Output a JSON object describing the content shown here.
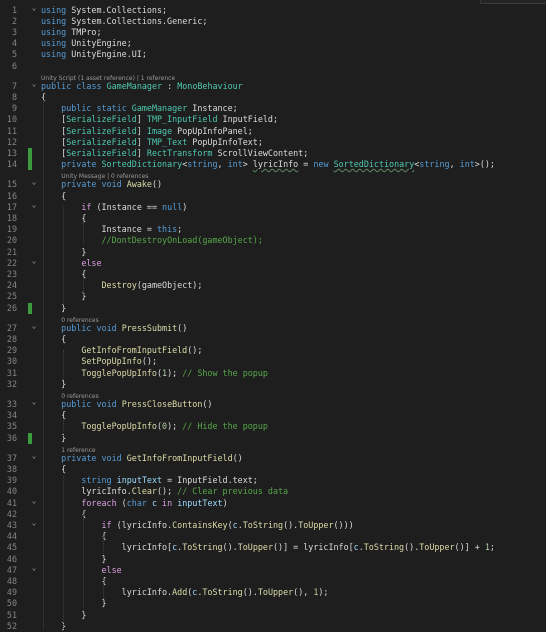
{
  "editor": {
    "language": "csharp",
    "theme_background": "#1e1e1e",
    "colors": {
      "keyword": "#569cd6",
      "control": "#d8a0df",
      "type": "#4ec9b0",
      "method": "#dcdcaa",
      "comment": "#57a64a",
      "variable": "#9cdcfe",
      "number": "#b5cea8",
      "text": "#dcdcdc",
      "line_number": "#858585",
      "change_marker": "#3c9b3c"
    },
    "lines": [
      {
        "n": "1",
        "fold": "collapse",
        "tokens": [
          [
            "kw",
            "using"
          ],
          [
            "pl",
            " System.Collections;"
          ]
        ]
      },
      {
        "n": "2",
        "tokens": [
          [
            "kw",
            "using"
          ],
          [
            "pl",
            " System.Collections.Generic;"
          ]
        ]
      },
      {
        "n": "3",
        "tokens": [
          [
            "kw",
            "using"
          ],
          [
            "pl",
            " TMPro;"
          ]
        ]
      },
      {
        "n": "4",
        "tokens": [
          [
            "kw",
            "using"
          ],
          [
            "pl",
            " UnityEngine;"
          ]
        ]
      },
      {
        "n": "5",
        "tokens": [
          [
            "kw",
            "using"
          ],
          [
            "pl",
            " UnityEngine.UI;"
          ]
        ]
      },
      {
        "n": "6",
        "tokens": []
      },
      {
        "lens": "Unity Script (1 asset reference) | 1 reference"
      },
      {
        "n": "7",
        "fold": "collapse",
        "tokens": [
          [
            "kw",
            "public"
          ],
          [
            "pl",
            " "
          ],
          [
            "kw",
            "class"
          ],
          [
            "pl",
            " "
          ],
          [
            "ty",
            "GameManager"
          ],
          [
            "pl",
            " : "
          ],
          [
            "ty",
            "MonoBehaviour"
          ]
        ]
      },
      {
        "n": "8",
        "tokens": [
          [
            "pl",
            "{"
          ]
        ]
      },
      {
        "n": "9",
        "tokens": [
          [
            "pl",
            "    "
          ],
          [
            "kw",
            "public"
          ],
          [
            "pl",
            " "
          ],
          [
            "kw",
            "static"
          ],
          [
            "pl",
            " "
          ],
          [
            "ty",
            "GameManager"
          ],
          [
            "pl",
            " Instance;"
          ]
        ]
      },
      {
        "n": "10",
        "tokens": [
          [
            "pl",
            "    ["
          ],
          [
            "at",
            "SerializeField"
          ],
          [
            "pl",
            "] "
          ],
          [
            "ty",
            "TMP_InputField"
          ],
          [
            "pl",
            " InputField;"
          ]
        ]
      },
      {
        "n": "11",
        "tokens": [
          [
            "pl",
            "    ["
          ],
          [
            "at",
            "SerializeField"
          ],
          [
            "pl",
            "] "
          ],
          [
            "ty",
            "Image"
          ],
          [
            "pl",
            " PopUpInfoPanel;"
          ]
        ]
      },
      {
        "n": "12",
        "tokens": [
          [
            "pl",
            "    ["
          ],
          [
            "at",
            "SerializeField"
          ],
          [
            "pl",
            "] "
          ],
          [
            "ty",
            "TMP_Text"
          ],
          [
            "pl",
            " PopUpInfoText;"
          ]
        ]
      },
      {
        "n": "13",
        "marker": true,
        "tokens": [
          [
            "pl",
            "    ["
          ],
          [
            "at",
            "SerializeField"
          ],
          [
            "pl",
            "] "
          ],
          [
            "ty",
            "RectTransform"
          ],
          [
            "pl",
            " ScrollViewContent;"
          ]
        ]
      },
      {
        "n": "14",
        "marker": true,
        "tokens": [
          [
            "pl",
            "    "
          ],
          [
            "kw",
            "private"
          ],
          [
            "pl",
            " "
          ],
          [
            "ty",
            "SortedDictionary"
          ],
          [
            "pl",
            "<"
          ],
          [
            "kw",
            "string"
          ],
          [
            "pl",
            ", "
          ],
          [
            "kw",
            "int"
          ],
          [
            "pl",
            "> "
          ],
          [
            "sq",
            "lyricInfo"
          ],
          [
            "pl",
            " = "
          ],
          [
            "kw",
            "new"
          ],
          [
            "pl",
            " "
          ],
          [
            "tysq",
            "SortedDictionary"
          ],
          [
            "pl",
            "<"
          ],
          [
            "kw",
            "string"
          ],
          [
            "pl",
            ", "
          ],
          [
            "kw",
            "int"
          ],
          [
            "pl",
            ">();"
          ]
        ]
      },
      {
        "lens": "Unity Message | 0 references",
        "indent": "    "
      },
      {
        "n": "15",
        "fold": "collapse",
        "tokens": [
          [
            "pl",
            "    "
          ],
          [
            "kw",
            "private"
          ],
          [
            "pl",
            " "
          ],
          [
            "kw",
            "void"
          ],
          [
            "pl",
            " "
          ],
          [
            "fn",
            "Awake"
          ],
          [
            "pl",
            "()"
          ]
        ]
      },
      {
        "n": "16",
        "tokens": [
          [
            "pl",
            "    {"
          ]
        ]
      },
      {
        "n": "17",
        "fold": "collapse",
        "tokens": [
          [
            "pl",
            "        "
          ],
          [
            "kw2",
            "if"
          ],
          [
            "pl",
            " (Instance == "
          ],
          [
            "kw",
            "null"
          ],
          [
            "pl",
            ")"
          ]
        ]
      },
      {
        "n": "18",
        "tokens": [
          [
            "pl",
            "        {"
          ]
        ]
      },
      {
        "n": "19",
        "tokens": [
          [
            "pl",
            "            Instance = "
          ],
          [
            "kw",
            "this"
          ],
          [
            "pl",
            ";"
          ]
        ]
      },
      {
        "n": "20",
        "tokens": [
          [
            "pl",
            "            "
          ],
          [
            "cm",
            "//DontDestroyOnLoad(gameObject);"
          ]
        ]
      },
      {
        "n": "21",
        "tokens": [
          [
            "pl",
            "        }"
          ]
        ]
      },
      {
        "n": "22",
        "fold": "collapse",
        "tokens": [
          [
            "pl",
            "        "
          ],
          [
            "kw2",
            "else"
          ]
        ]
      },
      {
        "n": "23",
        "tokens": [
          [
            "pl",
            "        {"
          ]
        ]
      },
      {
        "n": "24",
        "tokens": [
          [
            "pl",
            "            "
          ],
          [
            "fn",
            "Destroy"
          ],
          [
            "pl",
            "(gameObject);"
          ]
        ]
      },
      {
        "n": "25",
        "tokens": [
          [
            "pl",
            "        }"
          ]
        ]
      },
      {
        "n": "26",
        "marker": true,
        "tokens": [
          [
            "pl",
            "    }"
          ]
        ]
      },
      {
        "lens": "0 references",
        "indent": "    "
      },
      {
        "n": "27",
        "fold": "collapse",
        "tokens": [
          [
            "pl",
            "    "
          ],
          [
            "kw",
            "public"
          ],
          [
            "pl",
            " "
          ],
          [
            "kw",
            "void"
          ],
          [
            "pl",
            " "
          ],
          [
            "fn",
            "PressSubmit"
          ],
          [
            "pl",
            "()"
          ]
        ]
      },
      {
        "n": "28",
        "tokens": [
          [
            "pl",
            "    {"
          ]
        ]
      },
      {
        "n": "29",
        "tokens": [
          [
            "pl",
            "        "
          ],
          [
            "fn",
            "GetInfoFromInputField"
          ],
          [
            "pl",
            "();"
          ]
        ]
      },
      {
        "n": "30",
        "tokens": [
          [
            "pl",
            "        "
          ],
          [
            "fn",
            "SetPopUpInfo"
          ],
          [
            "pl",
            "();"
          ]
        ]
      },
      {
        "n": "31",
        "tokens": [
          [
            "pl",
            "        "
          ],
          [
            "fn",
            "TogglePopUpInfo"
          ],
          [
            "pl",
            "("
          ],
          [
            "nm",
            "1"
          ],
          [
            "pl",
            "); "
          ],
          [
            "cm",
            "// Show the popup"
          ]
        ]
      },
      {
        "n": "32",
        "tokens": [
          [
            "pl",
            "    }"
          ]
        ]
      },
      {
        "lens": "0 references",
        "indent": "    "
      },
      {
        "n": "33",
        "fold": "collapse",
        "tokens": [
          [
            "pl",
            "    "
          ],
          [
            "kw",
            "public"
          ],
          [
            "pl",
            " "
          ],
          [
            "kw",
            "void"
          ],
          [
            "pl",
            " "
          ],
          [
            "fn",
            "PressCloseButton"
          ],
          [
            "pl",
            "()"
          ]
        ]
      },
      {
        "n": "34",
        "tokens": [
          [
            "pl",
            "    {"
          ]
        ]
      },
      {
        "n": "35",
        "tokens": [
          [
            "pl",
            "        "
          ],
          [
            "fn",
            "TogglePopUpInfo"
          ],
          [
            "pl",
            "("
          ],
          [
            "nm",
            "0"
          ],
          [
            "pl",
            "); "
          ],
          [
            "cm",
            "// Hide the popup"
          ]
        ]
      },
      {
        "n": "36",
        "marker": true,
        "tokens": [
          [
            "pl",
            "    }"
          ]
        ]
      },
      {
        "lens": "1 reference",
        "indent": "    "
      },
      {
        "n": "37",
        "fold": "collapse",
        "tokens": [
          [
            "pl",
            "    "
          ],
          [
            "kw",
            "private"
          ],
          [
            "pl",
            " "
          ],
          [
            "kw",
            "void"
          ],
          [
            "pl",
            " "
          ],
          [
            "fn",
            "GetInfoFromInputField"
          ],
          [
            "pl",
            "()"
          ]
        ]
      },
      {
        "n": "38",
        "tokens": [
          [
            "pl",
            "    {"
          ]
        ]
      },
      {
        "n": "39",
        "tokens": [
          [
            "pl",
            "        "
          ],
          [
            "kw",
            "string"
          ],
          [
            "pl",
            " "
          ],
          [
            "vr",
            "inputText"
          ],
          [
            "pl",
            " = InputField.text;"
          ]
        ]
      },
      {
        "n": "40",
        "tokens": [
          [
            "pl",
            "        lyricInfo."
          ],
          [
            "fn",
            "Clear"
          ],
          [
            "pl",
            "(); "
          ],
          [
            "cm",
            "// Clear previous data"
          ]
        ]
      },
      {
        "n": "41",
        "fold": "collapse",
        "tokens": [
          [
            "pl",
            "        "
          ],
          [
            "kw2",
            "foreach"
          ],
          [
            "pl",
            " ("
          ],
          [
            "kw",
            "char"
          ],
          [
            "pl",
            " "
          ],
          [
            "vr",
            "c"
          ],
          [
            "pl",
            " "
          ],
          [
            "kw2",
            "in"
          ],
          [
            "pl",
            " "
          ],
          [
            "vr",
            "inputText"
          ],
          [
            "pl",
            ")"
          ]
        ]
      },
      {
        "n": "42",
        "tokens": [
          [
            "pl",
            "        {"
          ]
        ]
      },
      {
        "n": "43",
        "fold": "collapse",
        "tokens": [
          [
            "pl",
            "            "
          ],
          [
            "kw2",
            "if"
          ],
          [
            "pl",
            " (lyricInfo."
          ],
          [
            "fn",
            "ContainsKey"
          ],
          [
            "pl",
            "("
          ],
          [
            "vr",
            "c"
          ],
          [
            "pl",
            "."
          ],
          [
            "fn",
            "ToString"
          ],
          [
            "pl",
            "()."
          ],
          [
            "fn",
            "ToUpper"
          ],
          [
            "pl",
            "()))"
          ]
        ]
      },
      {
        "n": "44",
        "tokens": [
          [
            "pl",
            "            {"
          ]
        ]
      },
      {
        "n": "45",
        "tokens": [
          [
            "pl",
            "                lyricInfo["
          ],
          [
            "vr",
            "c"
          ],
          [
            "pl",
            "."
          ],
          [
            "fn",
            "ToString"
          ],
          [
            "pl",
            "()."
          ],
          [
            "fn",
            "ToUpper"
          ],
          [
            "pl",
            "()] = lyricInfo["
          ],
          [
            "vr",
            "c"
          ],
          [
            "pl",
            "."
          ],
          [
            "fn",
            "ToString"
          ],
          [
            "pl",
            "()."
          ],
          [
            "fn",
            "ToUpper"
          ],
          [
            "pl",
            "()] + "
          ],
          [
            "nm",
            "1"
          ],
          [
            "pl",
            ";"
          ]
        ]
      },
      {
        "n": "46",
        "tokens": [
          [
            "pl",
            "            }"
          ]
        ]
      },
      {
        "n": "47",
        "fold": "collapse",
        "tokens": [
          [
            "pl",
            "            "
          ],
          [
            "kw2",
            "else"
          ]
        ]
      },
      {
        "n": "48",
        "tokens": [
          [
            "pl",
            "            {"
          ]
        ]
      },
      {
        "n": "49",
        "tokens": [
          [
            "pl",
            "                lyricInfo."
          ],
          [
            "fn",
            "Add"
          ],
          [
            "pl",
            "("
          ],
          [
            "vr",
            "c"
          ],
          [
            "pl",
            "."
          ],
          [
            "fn",
            "ToString"
          ],
          [
            "pl",
            "()."
          ],
          [
            "fn",
            "ToUpper"
          ],
          [
            "pl",
            "(), "
          ],
          [
            "nm",
            "1"
          ],
          [
            "pl",
            ");"
          ]
        ]
      },
      {
        "n": "50",
        "tokens": [
          [
            "pl",
            "            }"
          ]
        ]
      },
      {
        "n": "51",
        "tokens": [
          [
            "pl",
            "        }"
          ]
        ]
      },
      {
        "n": "52",
        "tokens": [
          [
            "pl",
            "    }"
          ]
        ]
      }
    ]
  }
}
